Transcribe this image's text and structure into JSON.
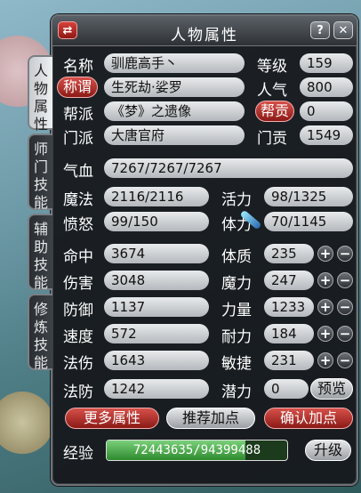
{
  "window": {
    "title": "人物属性",
    "help_label": "?",
    "close_label": "✕",
    "swap_label": "⇄"
  },
  "tabs": [
    {
      "label": "人物属性",
      "active": true
    },
    {
      "label": "师门技能",
      "active": false
    },
    {
      "label": "辅助技能",
      "active": false
    },
    {
      "label": "修炼技能",
      "active": false
    }
  ],
  "info": {
    "name_label": "名称",
    "name": "驯鹿高手丶",
    "level_label": "等级",
    "level": "159",
    "title_btn": "称谓",
    "title": "生死劫·娑罗",
    "pop_label": "人气",
    "popularity": "800",
    "guild_label": "帮派",
    "guild": "《梦》之遗像",
    "contrib_btn": "帮贡",
    "contribution": "0",
    "school_label": "门派",
    "school": "大唐官府",
    "school_contrib_label": "门贡",
    "school_contrib": "1549"
  },
  "vitals": {
    "hp_label": "气血",
    "hp": "7267/7267/7267",
    "mp_label": "魔法",
    "mp": "2116/2116",
    "vigor_label": "活力",
    "vigor": "98/1325",
    "rage_label": "愤怒",
    "rage": "99/150",
    "stamina_label": "体力",
    "stamina": "70/1145"
  },
  "stats": [
    {
      "label": "命中",
      "value": "3674",
      "attr_label": "体质",
      "attr_value": "235"
    },
    {
      "label": "伤害",
      "value": "3048",
      "attr_label": "魔力",
      "attr_value": "247"
    },
    {
      "label": "防御",
      "value": "1137",
      "attr_label": "力量",
      "attr_value": "1233"
    },
    {
      "label": "速度",
      "value": "572",
      "attr_label": "耐力",
      "attr_value": "184"
    },
    {
      "label": "法伤",
      "value": "1643",
      "attr_label": "敏捷",
      "attr_value": "231"
    }
  ],
  "mdef_label": "法防",
  "mdef": "1242",
  "potential_label": "潜力",
  "potential": "0",
  "preview_btn": "预览",
  "buttons": {
    "more": "更多属性",
    "recommend": "推荐加点",
    "confirm": "确认加点"
  },
  "exp": {
    "label": "经验",
    "text": "72443635/94399488",
    "fraction": 0.767
  },
  "upgrade_btn": "升级",
  "plus": "+",
  "minus": "−"
}
